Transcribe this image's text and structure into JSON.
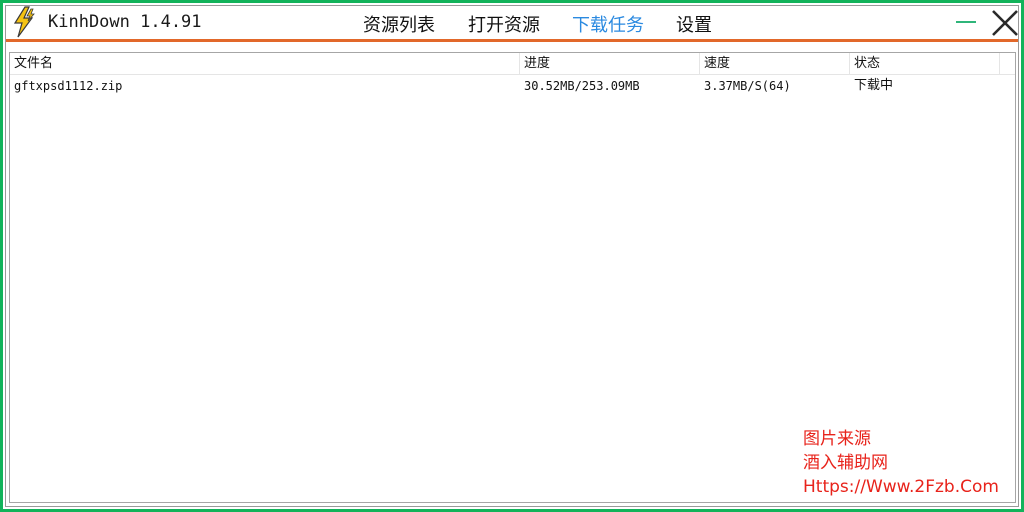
{
  "app": {
    "title": "KinhDown 1.4.91",
    "logo_icon": "lightning-bolt-icon"
  },
  "nav": {
    "items": [
      {
        "label": "资源列表",
        "active": false
      },
      {
        "label": "打开资源",
        "active": false
      },
      {
        "label": "下载任务",
        "active": true
      },
      {
        "label": "设置",
        "active": false
      }
    ]
  },
  "window_controls": {
    "minimize_icon": "minimize-icon",
    "close_icon": "close-icon"
  },
  "colors": {
    "frame_border": "#12b35a",
    "accent_bar": "#e2682a",
    "active_nav": "#2b8ae0",
    "watermark": "#e8231b"
  },
  "downloads": {
    "columns": [
      "文件名",
      "进度",
      "速度",
      "状态"
    ],
    "rows": [
      {
        "filename": "gftxpsd1112.zip",
        "progress": "30.52MB/253.09MB",
        "speed": "3.37MB/S(64)",
        "status": "下载中"
      }
    ]
  },
  "watermark": {
    "line1": "图片来源",
    "line2": "酒入辅助网",
    "line3": "Https://Www.2Fzb.Com"
  }
}
